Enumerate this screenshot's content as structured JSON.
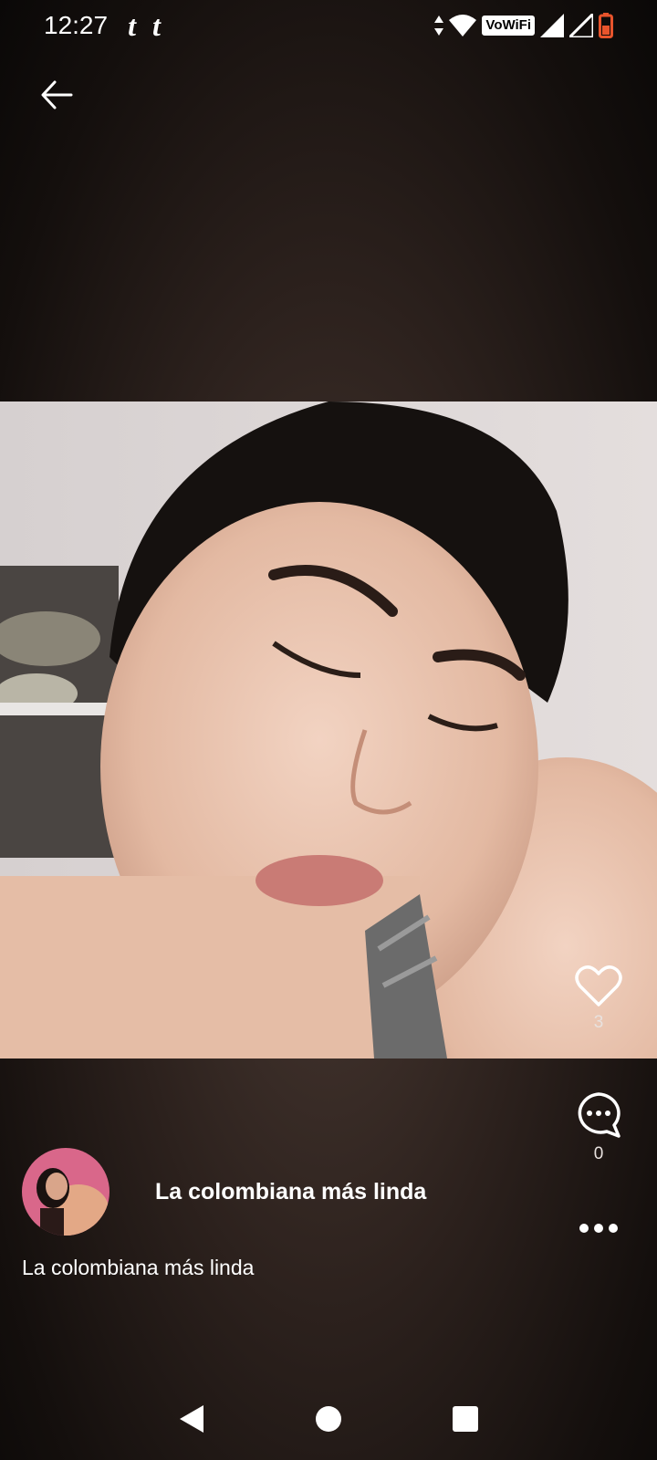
{
  "status_bar": {
    "time": "12:27",
    "notifications": [
      "tumblr-icon",
      "tumblr-icon"
    ],
    "notif_glyph": "t",
    "vowifi_label": "VoWiFi",
    "battery_color": "#e8542c"
  },
  "toolbar": {
    "back_icon": "arrow-left-icon"
  },
  "post": {
    "image_alt": "selfie-photo",
    "likes": {
      "icon": "heart-outline-icon",
      "count": "3"
    },
    "comments": {
      "icon": "comment-bubble-icon",
      "count": "0"
    },
    "more_icon": "more-horizontal-icon"
  },
  "user": {
    "display_name": "La colombiana más linda",
    "avatar": "avatar-image"
  },
  "caption": "La colombiana más linda",
  "nav": {
    "back_icon": "nav-back-triangle-icon",
    "home_icon": "nav-home-circle-icon",
    "recents_icon": "nav-recents-square-icon"
  },
  "colors": {
    "background_dark": "#1a1412",
    "text": "#ffffff",
    "accent_battery": "#e8542c"
  }
}
